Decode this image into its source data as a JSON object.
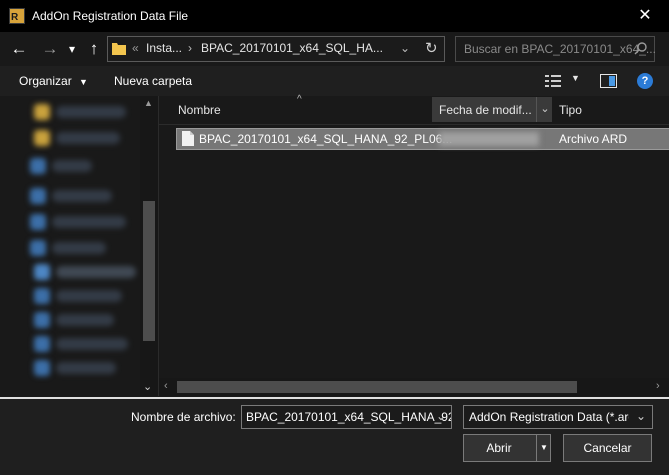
{
  "window": {
    "title": "AddOn Registration Data File",
    "close_glyph": "✕"
  },
  "nav": {
    "back_glyph": "←",
    "forward_glyph": "→",
    "recent_glyph": "▾",
    "up_glyph": "↑",
    "address_overflow": "«",
    "address_segments": [
      "Insta...",
      "BPAC_20170101_x64_SQL_HA..."
    ],
    "address_separator": "›",
    "dropdown_glyph": "⌄",
    "refresh_glyph": "↻",
    "search_placeholder": "Buscar en BPAC_20170101_x64_..."
  },
  "toolbar": {
    "organize_label": "Organizar",
    "new_folder_label": "Nueva carpeta",
    "help_glyph": "?"
  },
  "columns": {
    "name": "Nombre",
    "date": "Fecha de modif...",
    "type": "Tipo"
  },
  "files": [
    {
      "name": "BPAC_20170101_x64_SQL_HANA_92_PL06...",
      "type": "Archivo ARD"
    }
  ],
  "bottom": {
    "filename_label": "Nombre de archivo:",
    "filename_value": "BPAC_20170101_x64_SQL_HANA_92",
    "filter_value": "AddOn Registration Data (*.ard)",
    "open_label": "Abrir",
    "cancel_label": "Cancelar"
  },
  "colors": {
    "accent": "#2b7bd6",
    "folder": "#f3c54e",
    "selected_row": "#777777"
  }
}
